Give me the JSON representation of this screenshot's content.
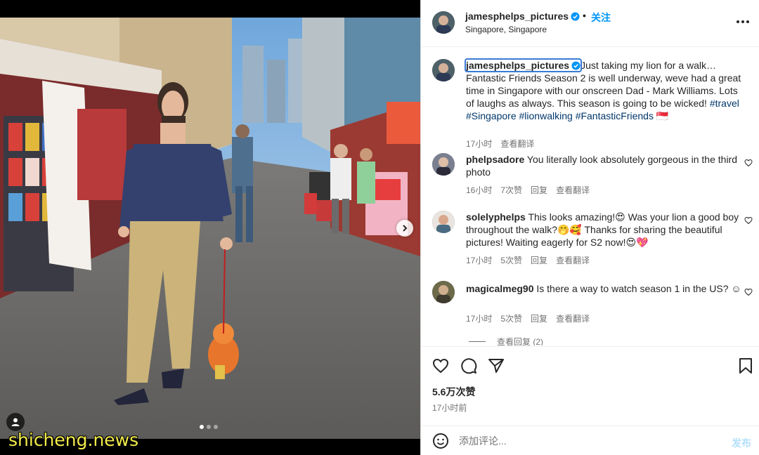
{
  "media": {
    "watermark": "shicheng.news",
    "carousel": {
      "total": 3,
      "active": 1
    },
    "next_icon": "chevron-right-icon",
    "tag_icon": "user-tag-icon"
  },
  "header": {
    "username": "jamesphelps_pictures",
    "dot": "•",
    "follow_label": "关注",
    "location": "Singapore, Singapore",
    "more_icon": "more-horizontal-icon"
  },
  "caption": {
    "username": "jamesphelps_pictures",
    "text": "Just taking my lion for a walk… Fantastic Friends Season 2 is well underway, weve had a great time in Singapore with our onscreen Dad - Mark Williams. Lots of laughs as always. This season is going to be wicked! ",
    "tags": [
      "#travel",
      "#Singapore",
      "#lionwalking",
      "#FantasticFriends"
    ],
    "flag": "🇸🇬",
    "time": "17小时",
    "translate": "查看翻译"
  },
  "comments": [
    {
      "username": "phelpsadore",
      "text": "You literally look absolutely gorgeous in the third photo",
      "time": "16小时",
      "likes": "7次赞",
      "reply": "回复",
      "translate": "查看翻译"
    },
    {
      "username": "solelyphelps",
      "text": "This looks amazing!😍 Was your lion a good boy throughout the walk?🤭🥰 Thanks for sharing the beautiful pictures! Waiting eagerly for S2 now!😍💖",
      "time": "17小时",
      "likes": "5次赞",
      "reply": "回复",
      "translate": "查看翻译"
    },
    {
      "username": "magicalmeg90",
      "text": "Is there a way to watch season 1 in the US? ☺",
      "time": "17小时",
      "likes": "5次赞",
      "reply": "回复",
      "translate": "查看翻译",
      "view_replies": "查看回复 (2)"
    }
  ],
  "actions": {
    "likes": "5.6万次赞",
    "posted": "17小时前",
    "icons": [
      "heart-icon",
      "comment-icon",
      "share-icon",
      "bookmark-icon"
    ]
  },
  "comment_box": {
    "placeholder": "添加评论...",
    "post_label": "发布",
    "emoji_icon": "emoji-icon"
  },
  "colors": {
    "link": "#00376b",
    "follow": "#0095f6",
    "watermark": "#f3ec4a"
  }
}
